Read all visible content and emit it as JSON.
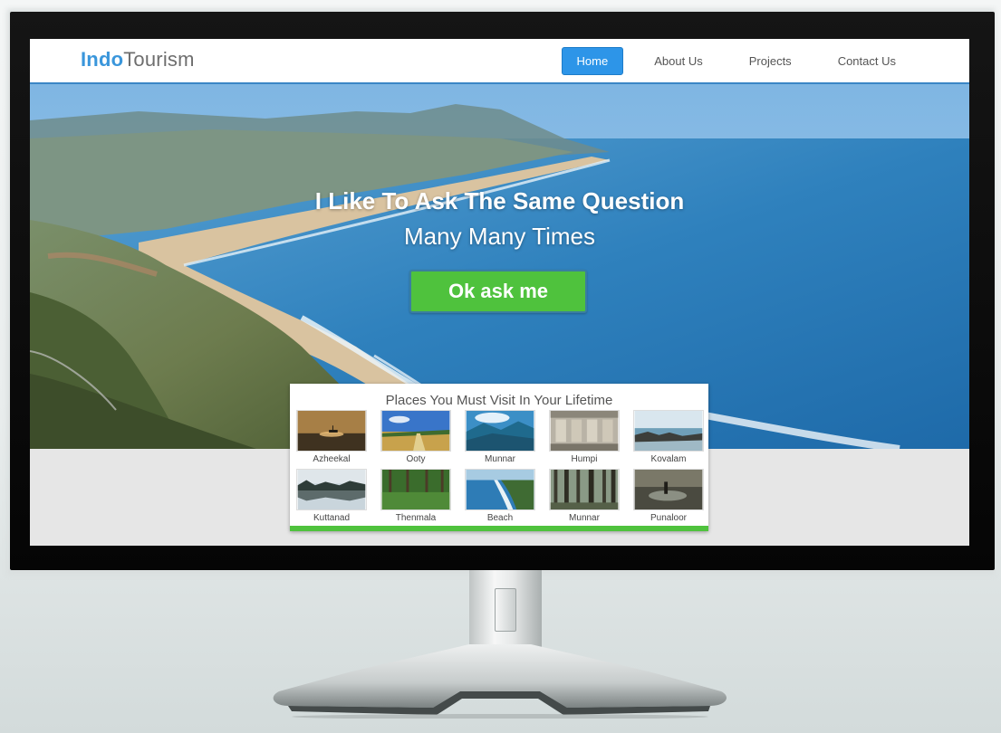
{
  "site": {
    "logo_bold": "Indo",
    "logo_rest": "Tourism",
    "nav": [
      {
        "label": "Home",
        "active": true
      },
      {
        "label": "About Us",
        "active": false
      },
      {
        "label": "Projects",
        "active": false
      },
      {
        "label": "Contact Us",
        "active": false
      }
    ]
  },
  "hero": {
    "title": "I Like To Ask The Same Question",
    "subtitle": "Many Many Times",
    "button_label": "Ok ask me"
  },
  "places": {
    "heading": "Places You Must Visit In Your Lifetime",
    "items": [
      {
        "name": "Azheekal",
        "thumb": "sunset-boat"
      },
      {
        "name": "Ooty",
        "thumb": "field-road"
      },
      {
        "name": "Munnar",
        "thumb": "blue-hills"
      },
      {
        "name": "Humpi",
        "thumb": "stone-carving"
      },
      {
        "name": "Kovalam",
        "thumb": "rocky-shore"
      },
      {
        "name": "Kuttanad",
        "thumb": "backwater"
      },
      {
        "name": "Thenmala",
        "thumb": "forest"
      },
      {
        "name": "Beach",
        "thumb": "coastline"
      },
      {
        "name": "Munnar",
        "thumb": "tall-trees"
      },
      {
        "name": "Punaloor",
        "thumb": "lake-figure"
      }
    ]
  },
  "colors": {
    "accent_blue": "#2d95e8",
    "button_green": "#4fc23d",
    "logo_blue": "#3a96db"
  }
}
